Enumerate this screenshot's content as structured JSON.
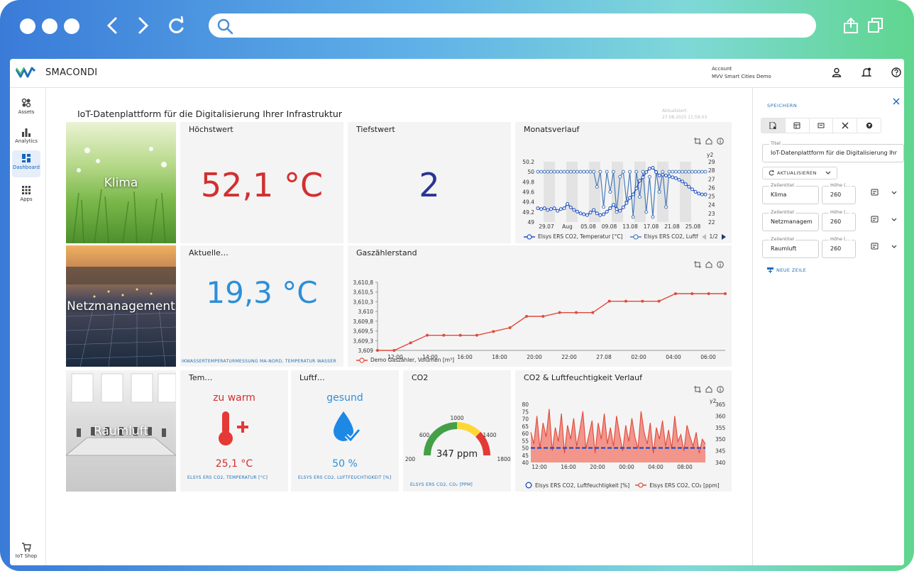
{
  "browser": {
    "url": ""
  },
  "app": {
    "brand": "SMACONDI",
    "account_label": "Account",
    "account_name": "MVV Smart Cities Demo"
  },
  "sidebar": {
    "items": [
      {
        "label": "Assets",
        "icon": "assets-icon"
      },
      {
        "label": "Analytics",
        "icon": "analytics-icon"
      },
      {
        "label": "Dashboard",
        "icon": "dashboard-icon",
        "active": true
      },
      {
        "label": "Apps",
        "icon": "apps-icon"
      }
    ],
    "shop": "IoT Shop"
  },
  "dashboard": {
    "title": "IoT-Datenplattform für die Digitalisierung Ihrer Infrastruktur",
    "updated_label": "Aktualisiert:",
    "updated_value": "27.08.2025 11:59:03",
    "rows": [
      {
        "label": "Klima"
      },
      {
        "label": "Netzmanagement"
      },
      {
        "label": "Raumluft"
      }
    ],
    "cards": {
      "hoechst": {
        "title": "Höchstwert",
        "value": "52,1 °C"
      },
      "tiefst": {
        "title": "Tiefstwert",
        "value": "2"
      },
      "monat": {
        "title": "Monatsverlauf",
        "legend1": "Elsys ERS CO2, Temperatur [°C]",
        "legend2": "Elsys ERS CO2, Luftfe",
        "pager": "1/2"
      },
      "aktuell": {
        "title": "Aktuelle…",
        "value": "19,3 °C",
        "footer": "IKWASSERTEMPERATURMESSUNG MA-NORD, TEMPERATUR WASSER"
      },
      "gas": {
        "title": "Gaszählerstand",
        "legend": "Demo Gaszähler, Volumen [m³]"
      },
      "temp": {
        "title": "Tem…",
        "status": "zu warm",
        "value": "25,1 °C",
        "footer": "ELSYS ERS CO2, TEMPERATUR [°C]"
      },
      "luft": {
        "title": "Luftf…",
        "status": "gesund",
        "value": "50 %",
        "footer": "ELSYS ERS CO2, LUFTFEUCHTIGKEIT [%]"
      },
      "co2": {
        "title": "CO2",
        "value": "347 ppm",
        "footer": "ELSYS ERS CO2, CO₂ [PPM]",
        "ticks": [
          "200",
          "600",
          "1000",
          "1400",
          "1800"
        ]
      },
      "co2luft": {
        "title": "CO2 & Luftfeuchtigkeit Verlauf",
        "legend1": "Elsys ERS CO2, Luftfeuchtigkeit [%]",
        "legend2": "Elsys ERS CO2, CO₂ [ppm]"
      }
    }
  },
  "panel": {
    "save": "SPEICHERN",
    "title_label": "Titel",
    "title_value": "IoT-Datenplattform für die Digitalisierung Ihr",
    "refresh": "AKTUALISIEREN",
    "rows": [
      {
        "row_label": "Zeilentitel",
        "row_value": "Klima",
        "height_label": "Höhe (…",
        "height_value": "260"
      },
      {
        "row_label": "Zeilentitel",
        "row_value": "Netzmanagem",
        "height_label": "Höhe (…",
        "height_value": "260"
      },
      {
        "row_label": "Zeilentitel",
        "row_value": "Raumluft",
        "height_label": "Höhe (…",
        "height_value": "260"
      }
    ],
    "new_row": "NEUE ZEILE"
  },
  "chart_data": [
    {
      "type": "line",
      "title": "Monatsverlauf",
      "x_ticks": [
        "29.07",
        "Aug",
        "05.08",
        "09.08",
        "13.08",
        "17.08",
        "21.08",
        "25.08"
      ],
      "y_ticks": [
        "49",
        "49.2",
        "49.4",
        "49.6",
        "49.8",
        "50",
        "50.2"
      ],
      "y2_label": "y2",
      "y2_ticks": [
        "22",
        "23",
        "24",
        "25",
        "26",
        "27",
        "28",
        "29"
      ],
      "ylim": [
        49,
        50.2
      ],
      "y2lim": [
        22,
        29
      ],
      "series": [
        {
          "name": "Elsys ERS CO2, Temperatur [°C]",
          "axis": "y2",
          "values": [
            23.6,
            23.5,
            23.6,
            23.4,
            23.5,
            23.6,
            23.3,
            23.5,
            23.6,
            24.1,
            23.7,
            23.4,
            23.2,
            23.0,
            22.9,
            22.8,
            23.1,
            23.4,
            23.0,
            22.8,
            22.9,
            23.2,
            23.6,
            24.0,
            23.5,
            23.3,
            23.7,
            24.2,
            24.8,
            25.2,
            25.9,
            26.8,
            27.2,
            27.8,
            28.2,
            28.3,
            27.8,
            27.4,
            27.5,
            27.4,
            27.3,
            27.2,
            27.1,
            26.9,
            26.7,
            26.4,
            26.1,
            25.8,
            25.5,
            25.3,
            25.2,
            25.2
          ]
        },
        {
          "name": "Elsys ERS CO2, Luftfeuchtigkeit [%]",
          "axis": "y",
          "values": [
            50,
            50,
            50,
            50,
            50,
            50,
            50,
            50,
            50,
            50,
            50,
            50,
            50,
            50,
            50,
            50,
            50,
            50,
            49.7,
            50,
            49.3,
            50,
            49.6,
            50,
            49.2,
            49.9,
            50,
            49.4,
            50,
            49.1,
            50,
            49.5,
            50,
            49.2,
            49.9,
            49.1,
            50,
            49.6,
            50,
            49.3,
            50,
            50,
            50,
            50,
            50,
            50,
            50,
            50,
            50,
            50,
            50,
            50
          ]
        }
      ]
    },
    {
      "type": "line",
      "title": "Gaszählerstand",
      "series": [
        {
          "name": "Demo Gaszähler, Volumen [m³]",
          "values": [
            3609.0,
            3609.0,
            3609.2,
            3609.4,
            3609.4,
            3609.4,
            3609.4,
            3609.5,
            3609.6,
            3609.9,
            3609.9,
            3610.0,
            3610.0,
            3610.0,
            3610.3,
            3610.3,
            3610.3,
            3610.3,
            3610.5,
            3610.5,
            3610.5,
            3610.5
          ]
        }
      ],
      "x_ticks": [
        "12:00",
        "14:00",
        "16:00",
        "18:00",
        "20:00",
        "22:00",
        "27.08",
        "02:00",
        "04:00",
        "06:00"
      ],
      "y_ticks": [
        "3,609",
        "3,609,3",
        "3,609,5",
        "3,609,8",
        "3,610",
        "3,610,3",
        "3,610,5",
        "3,610,8"
      ],
      "ylim": [
        3609,
        3610.8
      ]
    },
    {
      "type": "line",
      "title": "CO2 & Luftfeuchtigkeit Verlauf",
      "x_ticks": [
        "12:00",
        "16:00",
        "20:00",
        "00:00",
        "04:00",
        "08:00"
      ],
      "y_ticks": [
        "40",
        "45",
        "50",
        "55",
        "60",
        "65",
        "70",
        "75",
        "80"
      ],
      "y2_label": "y2",
      "y2_ticks": [
        "340",
        "345",
        "350",
        "355",
        "360",
        "365"
      ],
      "ylim": [
        40,
        80
      ],
      "y2lim": [
        340,
        365
      ],
      "series": [
        {
          "name": "Elsys ERS CO2, Luftfeuchtigkeit [%]",
          "axis": "y",
          "values": [
            50,
            50,
            50,
            50,
            50,
            50,
            50,
            50,
            50,
            50,
            50,
            50,
            50,
            50,
            50,
            50,
            50,
            50,
            50,
            50
          ]
        },
        {
          "name": "Elsys ERS CO2, CO₂ [ppm]",
          "axis": "y2",
          "values": [
            353,
            348,
            360,
            346,
            357,
            351,
            363,
            345,
            355,
            349,
            361,
            344,
            356,
            350,
            359,
            347,
            354,
            362,
            346,
            352,
            358,
            344,
            357,
            350,
            361,
            348,
            355,
            347,
            360,
            352,
            345,
            356,
            349,
            359,
            351,
            346,
            362,
            353,
            348,
            357,
            344,
            355,
            350,
            358,
            347,
            354,
            346,
            360,
            349,
            352,
            345,
            356,
            351,
            347,
            353,
            344,
            350,
            348
          ]
        }
      ]
    }
  ]
}
